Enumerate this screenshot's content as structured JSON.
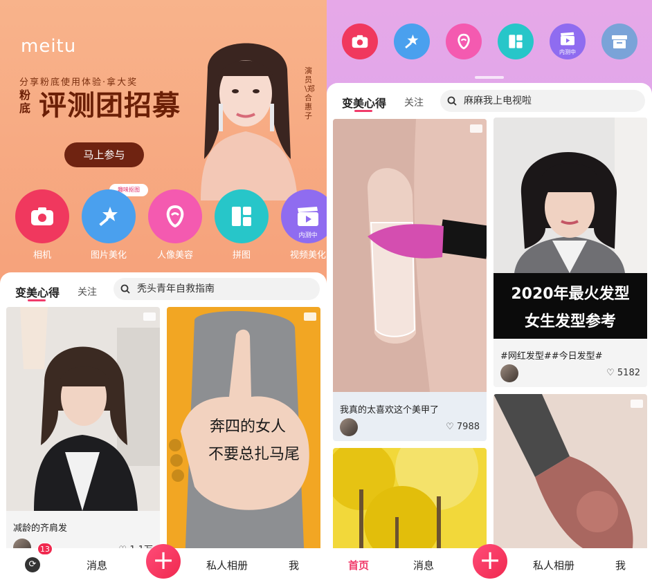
{
  "left": {
    "logo": "meitu",
    "banner": {
      "subtitle": "分享粉底使用体验·拿大奖",
      "small_title": "粉底",
      "title": "评测团招募",
      "cta": "马上参与",
      "credit": "演员\\郑合惠子"
    },
    "tools": [
      {
        "label": "相机",
        "icon": "camera-icon",
        "color": "#f0385e"
      },
      {
        "label": "图片美化",
        "icon": "magic-wand-icon",
        "color": "#4aa0ee",
        "tag": "趣味抠图"
      },
      {
        "label": "人像美容",
        "icon": "face-outline-icon",
        "color": "#f45ab0"
      },
      {
        "label": "拼图",
        "icon": "collage-icon",
        "color": "#27c6c9"
      },
      {
        "label": "视频美化",
        "icon": "clapperboard-icon",
        "color": "#8f6cf0",
        "tag": "内测中"
      }
    ],
    "feed": {
      "tab_active": "变美心得",
      "tab_other": "关注",
      "search_placeholder": "秃头青年自救指南",
      "cards": [
        {
          "title": "减龄的齐肩发",
          "likes": "1.1万"
        },
        {
          "handwriting_line1": "奔四的女人",
          "handwriting_line2": "不要总扎马尾"
        }
      ]
    },
    "nav": {
      "badge": "13",
      "messages": "消息",
      "album": "私人相册",
      "me": "我"
    }
  },
  "right": {
    "tools": [
      {
        "icon": "camera-icon",
        "color": "#f0385e"
      },
      {
        "icon": "magic-wand-icon",
        "color": "#4aa0ee"
      },
      {
        "icon": "face-outline-icon",
        "color": "#f45ab0"
      },
      {
        "icon": "collage-icon",
        "color": "#27c6c9"
      },
      {
        "icon": "clapperboard-icon",
        "color": "#8f6cf0",
        "tag": "内测中"
      },
      {
        "icon": "archive-icon",
        "color": "#7aa3d8"
      }
    ],
    "feed": {
      "tab_active": "变美心得",
      "tab_other": "关注",
      "search_placeholder": "麻麻我上电视啦",
      "cards": [
        {
          "title": "我真的太喜欢这个美甲了",
          "likes": "7988"
        },
        {
          "overlay_line1": "2020年最火发型",
          "overlay_line2": "女生发型参考",
          "title": "#网红发型##今日发型#",
          "likes": "5182"
        },
        {},
        {}
      ]
    },
    "nav": {
      "home": "首页",
      "messages": "消息",
      "album": "私人相册",
      "me": "我"
    }
  },
  "colors": {
    "accent": "#f03b6a",
    "banner_text": "#6b1f06"
  }
}
